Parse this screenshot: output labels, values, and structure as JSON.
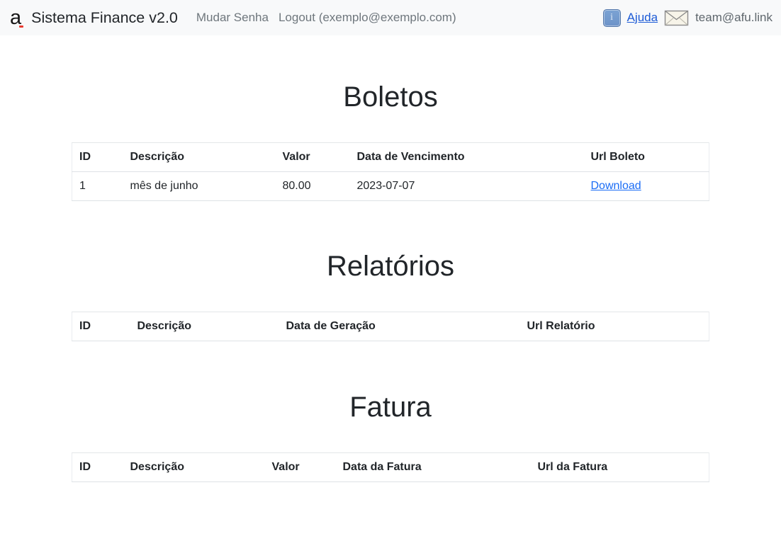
{
  "navbar": {
    "logo_glyph": "a",
    "logo_name": "brand-logo-a",
    "title": "Sistema Finance v2.0",
    "links": [
      {
        "label": "Mudar Senha",
        "name": "nav-link-mudar-senha"
      },
      {
        "label": "Logout (exemplo@exemplo.com)",
        "name": "nav-link-logout"
      }
    ],
    "info_icon_glyph": "i",
    "help_label": "Ajuda",
    "mail_icon_name": "envelope-icon",
    "account_email": "team@afu.link",
    "colors": {
      "background": "#f8f9fa",
      "muted_text": "#6f777d",
      "link": "#1d5bd6",
      "logo_dot": "#e8392f",
      "info_icon_fill": "#7ba3d4",
      "info_icon_border": "#4f74a8",
      "mail_icon_fill": "#f7f4e9",
      "mail_icon_stroke": "#8a8a8a"
    }
  },
  "sections": {
    "boletos": {
      "title": "Boletos",
      "columns": [
        "ID",
        "Descrição",
        "Valor",
        "Data de Vencimento",
        "Url Boleto"
      ],
      "rows": [
        {
          "id": "1",
          "descricao": "mês de junho",
          "valor": "80.00",
          "data": "2023-07-07",
          "url_label": "Download"
        }
      ]
    },
    "relatorios": {
      "title": "Relatórios",
      "columns": [
        "ID",
        "Descrição",
        "Data de Geração",
        "Url Relatório"
      ],
      "rows": []
    },
    "fatura": {
      "title": "Fatura",
      "columns": [
        "ID",
        "Descrição",
        "Valor",
        "Data da Fatura",
        "Url da Fatura"
      ],
      "rows": []
    }
  }
}
